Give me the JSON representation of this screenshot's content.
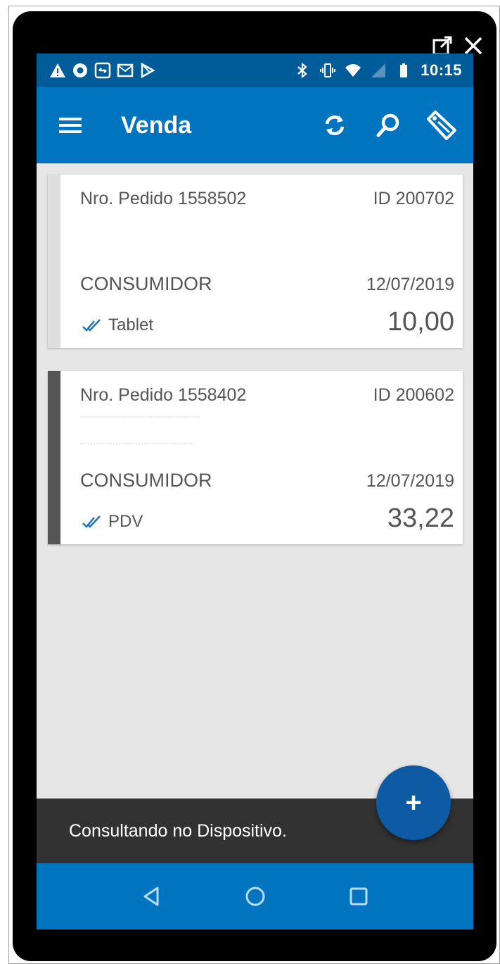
{
  "status_bar": {
    "time": "10:15",
    "left_icons": [
      "warning-icon",
      "record-icon",
      "sync-box-icon",
      "mail-icon",
      "play-store-icon"
    ],
    "right_icons": [
      "bluetooth-icon",
      "vibrate-icon",
      "wifi-icon",
      "no-signal-icon",
      "battery-icon"
    ]
  },
  "app_bar": {
    "title": "Venda"
  },
  "orders": [
    {
      "order_label": "Nro. Pedido 1558502",
      "id_label": "ID 200702",
      "customer": "CONSUMIDOR",
      "date": "12/07/2019",
      "source": "Tablet",
      "total": "10,00",
      "stripe_color": "#dedede"
    },
    {
      "order_label": "Nro. Pedido 1558402",
      "id_label": "ID 200602",
      "customer": "CONSUMIDOR",
      "date": "12/07/2019",
      "source": "PDV",
      "total": "33,22",
      "stripe_color": "#555555"
    }
  ],
  "snackbar": {
    "message": "Consultando no Dispositivo."
  },
  "fab": {
    "label": "+"
  },
  "colors": {
    "status_bar": "#005c99",
    "app_bar": "#0074bf",
    "fab": "#0e5aa3",
    "snackbar": "#323232",
    "check_icon": "#1e73be"
  }
}
